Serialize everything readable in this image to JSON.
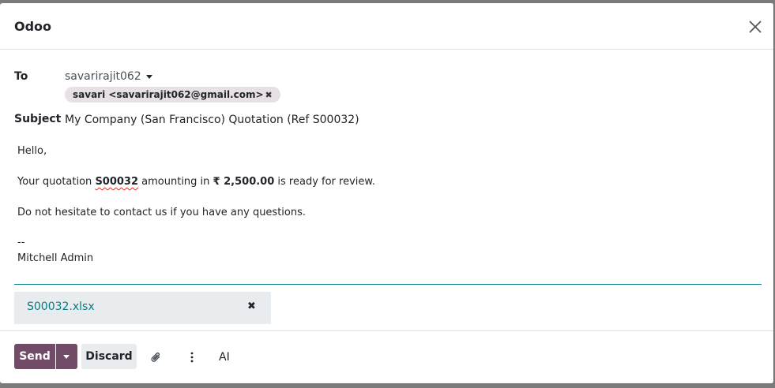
{
  "dialog": {
    "title": "Odoo"
  },
  "to": {
    "label": "To",
    "value": "savarirajit062",
    "tag": "savari <savarirajit062@gmail.com>"
  },
  "subject": {
    "label": "Subject",
    "value": "My Company (San Francisco) Quotation (Ref S00032)"
  },
  "body": {
    "greeting": "Hello,",
    "line2_pre": "Your quotation ",
    "quotation_ref": "S00032",
    "line2_mid": " amounting in ",
    "amount": "₹ 2,500.00",
    "line2_post": " is ready for review.",
    "line3": "Do not hesitate to contact us if you have any questions.",
    "sig_sep": "--",
    "signature": "Mitchell Admin"
  },
  "attachment": {
    "name": "S00032.xlsx"
  },
  "footer": {
    "send_label": "Send",
    "discard_label": "Discard",
    "ai_label": "AI"
  },
  "colors": {
    "primary": "#714b67",
    "accent": "#017e84",
    "tag_bg": "#e7e0e4"
  },
  "icons": [
    "close-icon",
    "caret-down-icon",
    "remove-icon",
    "paperclip-icon",
    "vertical-ellipsis-icon"
  ]
}
